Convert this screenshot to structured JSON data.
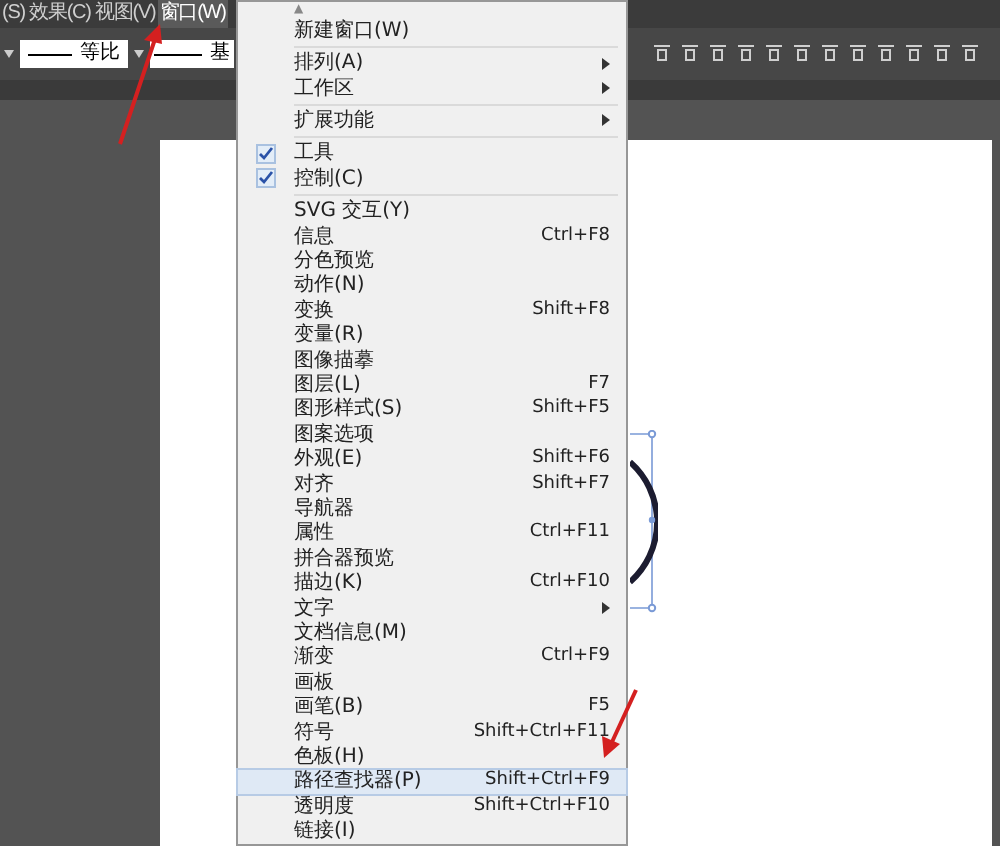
{
  "menubar": [
    {
      "label": "(S)",
      "selected": false
    },
    {
      "label": "效果(C)",
      "selected": false
    },
    {
      "label": "视图(V)",
      "selected": false
    },
    {
      "label": "窗口(W)",
      "selected": true
    }
  ],
  "toolbar": {
    "stroke_profile": "等比",
    "brush": "基"
  },
  "menu": {
    "scroll_up": "▲",
    "items": [
      {
        "kind": "item",
        "label": "新建窗口(W)",
        "checked": false,
        "selected": false
      },
      {
        "kind": "separator"
      },
      {
        "kind": "submenu",
        "label": "排列(A)",
        "checked": false,
        "selected": false
      },
      {
        "kind": "submenu",
        "label": "工作区",
        "checked": false,
        "selected": false
      },
      {
        "kind": "separator"
      },
      {
        "kind": "submenu",
        "label": "扩展功能",
        "checked": false,
        "selected": false
      },
      {
        "kind": "separator"
      },
      {
        "kind": "item",
        "label": "工具",
        "checked": true,
        "selected": false
      },
      {
        "kind": "item",
        "label": "控制(C)",
        "checked": true,
        "selected": false
      },
      {
        "kind": "separator"
      },
      {
        "kind": "item",
        "label": "SVG 交互(Y)",
        "checked": false,
        "selected": false
      },
      {
        "kind": "item",
        "label": "信息",
        "shortcut": "Ctrl+F8",
        "checked": false,
        "selected": false
      },
      {
        "kind": "item",
        "label": "分色预览",
        "checked": false,
        "selected": false
      },
      {
        "kind": "item",
        "label": "动作(N)",
        "checked": false,
        "selected": false
      },
      {
        "kind": "item",
        "label": "变换",
        "shortcut": "Shift+F8",
        "checked": false,
        "selected": false
      },
      {
        "kind": "item",
        "label": "变量(R)",
        "checked": false,
        "selected": false
      },
      {
        "kind": "item",
        "label": "图像描摹",
        "checked": false,
        "selected": false
      },
      {
        "kind": "item",
        "label": "图层(L)",
        "shortcut": "F7",
        "checked": false,
        "selected": false
      },
      {
        "kind": "item",
        "label": "图形样式(S)",
        "shortcut": "Shift+F5",
        "checked": false,
        "selected": false
      },
      {
        "kind": "item",
        "label": "图案选项",
        "checked": false,
        "selected": false
      },
      {
        "kind": "item",
        "label": "外观(E)",
        "shortcut": "Shift+F6",
        "checked": false,
        "selected": false
      },
      {
        "kind": "item",
        "label": "对齐",
        "shortcut": "Shift+F7",
        "checked": false,
        "selected": false
      },
      {
        "kind": "item",
        "label": "导航器",
        "checked": false,
        "selected": false
      },
      {
        "kind": "item",
        "label": "属性",
        "shortcut": "Ctrl+F11",
        "checked": false,
        "selected": false
      },
      {
        "kind": "item",
        "label": "拼合器预览",
        "checked": false,
        "selected": false
      },
      {
        "kind": "item",
        "label": "描边(K)",
        "shortcut": "Ctrl+F10",
        "checked": false,
        "selected": false
      },
      {
        "kind": "submenu",
        "label": "文字",
        "checked": false,
        "selected": false
      },
      {
        "kind": "item",
        "label": "文档信息(M)",
        "checked": false,
        "selected": false
      },
      {
        "kind": "item",
        "label": "渐变",
        "shortcut": "Ctrl+F9",
        "checked": false,
        "selected": false
      },
      {
        "kind": "item",
        "label": "画板",
        "checked": false,
        "selected": false
      },
      {
        "kind": "item",
        "label": "画笔(B)",
        "shortcut": "F5",
        "checked": false,
        "selected": false
      },
      {
        "kind": "item",
        "label": "符号",
        "shortcut": "Shift+Ctrl+F11",
        "checked": false,
        "selected": false
      },
      {
        "kind": "item",
        "label": "色板(H)",
        "checked": false,
        "selected": false
      },
      {
        "kind": "item",
        "label": "路径查找器(P)",
        "shortcut": "Shift+Ctrl+F9",
        "checked": false,
        "selected": true
      },
      {
        "kind": "item",
        "label": "透明度",
        "shortcut": "Shift+Ctrl+F10",
        "checked": false,
        "selected": false
      },
      {
        "kind": "item",
        "label": "链接(I)",
        "checked": false,
        "selected": false
      }
    ]
  }
}
